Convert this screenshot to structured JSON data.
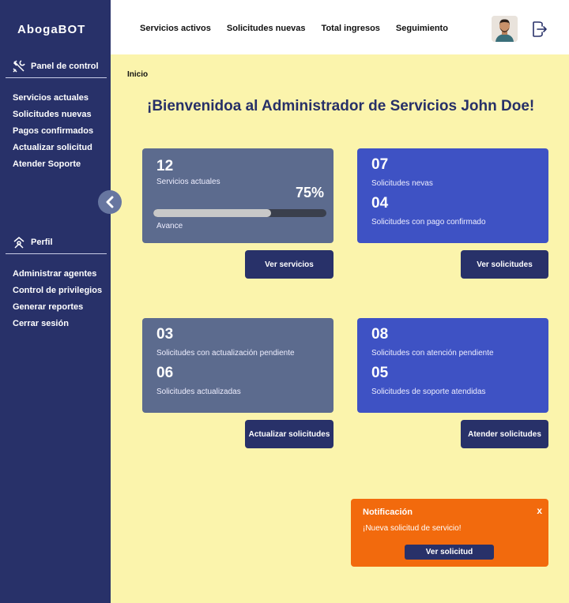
{
  "sidebar": {
    "logo": "AbogaBOT",
    "panel_title": "Panel de control",
    "panel_items": [
      "Servicios actuales",
      "Solicitudes nuevas",
      "Pagos confirmados",
      "Actualizar solicitud",
      "Atender Soporte"
    ],
    "profile_title": "Perfil",
    "profile_items": [
      "Administrar agentes",
      "Control de privilegios",
      "Generar reportes",
      "Cerrar sesión"
    ]
  },
  "topbar": {
    "nav": [
      "Servicios activos",
      "Solicitudes nuevas",
      "Total ingresos",
      "Seguimiento"
    ]
  },
  "main": {
    "breadcrumb": "Inicio",
    "welcome": "¡Bienvenidoa al Administrador de Servicios John Doe!",
    "card1": {
      "num": "12",
      "label": "Servicios actuales",
      "percent": "75%",
      "progress": 0.68,
      "sub": "Avance"
    },
    "card2": {
      "num1": "07",
      "label1": "Solicitudes nevas",
      "num2": "04",
      "label2": "Solicitudes con pago confirmado"
    },
    "card3": {
      "num1": "03",
      "label1": "Solicitudes con actualización pendiente",
      "num2": "06",
      "label2": "Solicitudes actualizadas"
    },
    "card4": {
      "num1": "08",
      "label1": "Solicitudes con atención pendiente",
      "num2": "05",
      "label2": "Solicitudes de soporte atendidas"
    },
    "buttons": {
      "ver_servicios": "Ver servicios",
      "ver_solicitudes": "Ver solicitudes",
      "actualizar": "Actualizar solicitudes",
      "atender": "Atender solicitudes"
    }
  },
  "notification": {
    "title": "Notificación",
    "close": "x",
    "message": "¡Nueva solicitud de servicio!",
    "button": "Ver solicitud"
  },
  "colors": {
    "sidebar": "#283169",
    "background": "#fbf4ac",
    "card_gray": "#5c6b8e",
    "card_blue": "#3e52c4",
    "notification": "#f26a0d"
  }
}
